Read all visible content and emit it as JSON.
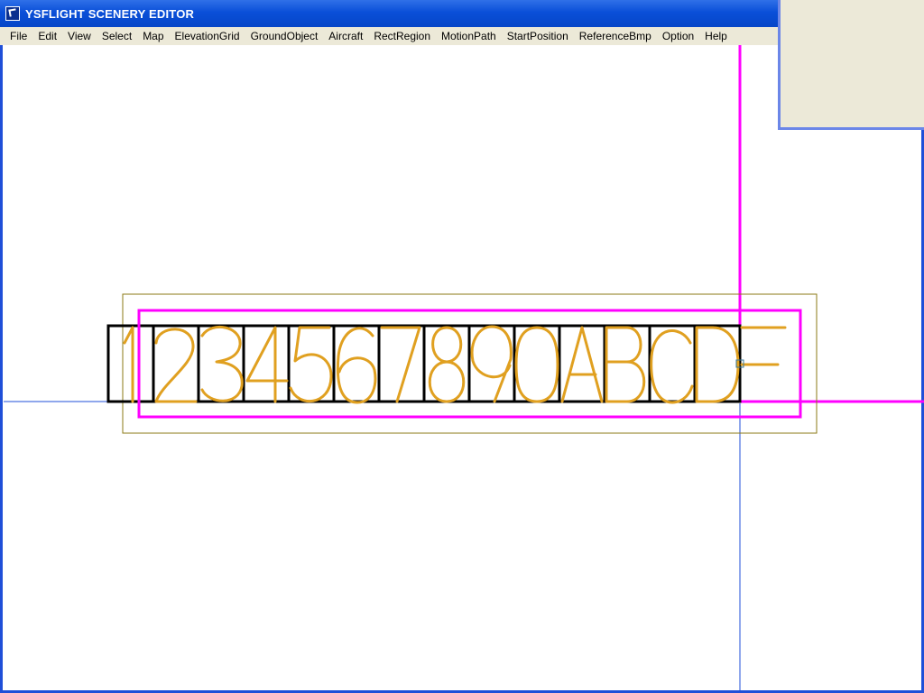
{
  "window": {
    "title": "YSFLIGHT SCENERY EDITOR",
    "icon": "ysflight-app-icon"
  },
  "menubar": {
    "items": [
      {
        "label": "File",
        "accelerator": "F"
      },
      {
        "label": "Edit",
        "accelerator": "E"
      },
      {
        "label": "View",
        "accelerator": "V"
      },
      {
        "label": "Select",
        "accelerator": ""
      },
      {
        "label": "Map",
        "accelerator": "M"
      },
      {
        "label": "ElevationGrid",
        "accelerator": "G"
      },
      {
        "label": "GroundObject",
        "accelerator": "O"
      },
      {
        "label": "Aircraft",
        "accelerator": ""
      },
      {
        "label": "RectRegion",
        "accelerator": "t"
      },
      {
        "label": "MotionPath",
        "accelerator": "P"
      },
      {
        "label": "StartPosition",
        "accelerator": "a"
      },
      {
        "label": "ReferenceBmp",
        "accelerator": ""
      },
      {
        "label": "Option",
        "accelerator": ""
      },
      {
        "label": "Help",
        "accelerator": ""
      }
    ]
  },
  "scene": {
    "sign_text": "1234567890ABCDE",
    "colors": {
      "accent_blue": "#1f4fd8",
      "selection_magenta": "#ff00ff",
      "glyph_gold": "#e0a020",
      "outline_olive": "#8b7a14",
      "frame_black": "#000000",
      "panel_beige": "#ece9d8"
    }
  }
}
